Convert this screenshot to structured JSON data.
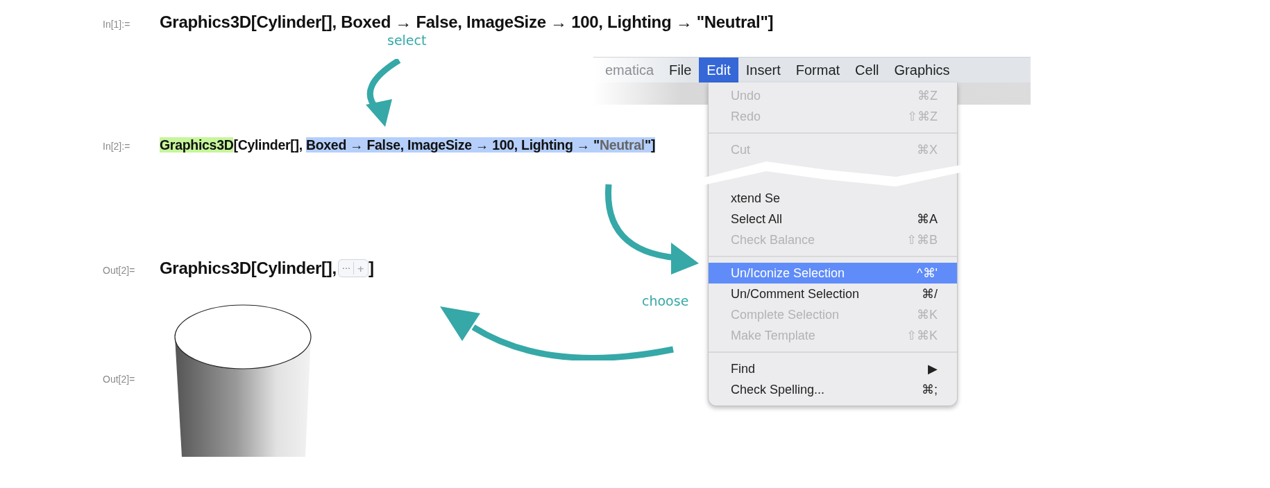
{
  "cells": [
    {
      "kind": "input",
      "label": "In[1]:=",
      "segments": [
        {
          "text": "Graphics3D[Cylinder[], Boxed → False, ImageSize → 100, Lighting → \"Neutral\"]",
          "kind": "plain"
        }
      ]
    },
    {
      "kind": "input-small",
      "label": "In[2]:=",
      "segments": [
        {
          "text": "Graphics3D",
          "kind": "symbol-highlight"
        },
        {
          "text": "[Cylinder[], ",
          "kind": "plain"
        },
        {
          "text": "Boxed → False, ImageSize → 100, Lighting → \"",
          "kind": "selected"
        },
        {
          "text": "Neutral",
          "kind": "selected-string"
        },
        {
          "text": "\"]",
          "kind": "selected"
        }
      ]
    },
    {
      "kind": "output-iconized",
      "label": "Out[2]=",
      "prefix": "Graphics3D[Cylinder[], ",
      "icon_box": {
        "dots": "···",
        "plus": "+"
      },
      "suffix": "]"
    },
    {
      "kind": "output-graphic",
      "label": "Out[2]="
    }
  ],
  "annotations": [
    {
      "text": "select"
    },
    {
      "text": "choose"
    }
  ],
  "menubar": [
    {
      "label": "ematica",
      "selected": false,
      "faded": true
    },
    {
      "label": "File",
      "selected": false,
      "faded": false
    },
    {
      "label": "Edit",
      "selected": true,
      "faded": false
    },
    {
      "label": "Insert",
      "selected": false,
      "faded": false
    },
    {
      "label": "Format",
      "selected": false,
      "faded": false
    },
    {
      "label": "Cell",
      "selected": false,
      "faded": false
    },
    {
      "label": "Graphics",
      "selected": false,
      "faded": false
    }
  ],
  "menu": [
    {
      "kind": "item",
      "label": "Undo",
      "shortcut": "⌘Z",
      "disabled": true,
      "selected": false
    },
    {
      "kind": "item",
      "label": "Redo",
      "shortcut": "⇧⌘Z",
      "disabled": true,
      "selected": false
    },
    {
      "kind": "separator"
    },
    {
      "kind": "item",
      "label": "Cut",
      "shortcut": "⌘X",
      "disabled": true,
      "selected": false
    },
    {
      "kind": "break"
    },
    {
      "kind": "item",
      "label": "xtend Se",
      "disabled": false,
      "selected": false
    },
    {
      "kind": "item",
      "label": "Select All",
      "shortcut": "⌘A",
      "disabled": false,
      "selected": false
    },
    {
      "kind": "item",
      "label": "Check Balance",
      "shortcut": "⇧⌘B",
      "disabled": true,
      "selected": false
    },
    {
      "kind": "separator"
    },
    {
      "kind": "item",
      "label": "Un/Iconize Selection",
      "shortcut": "^⌘'",
      "disabled": false,
      "selected": true
    },
    {
      "kind": "item",
      "label": "Un/Comment Selection",
      "shortcut": "⌘/",
      "disabled": false,
      "selected": false
    },
    {
      "kind": "item",
      "label": "Complete Selection",
      "shortcut": "⌘K",
      "disabled": true,
      "selected": false
    },
    {
      "kind": "item",
      "label": "Make Template",
      "shortcut": "⇧⌘K",
      "disabled": true,
      "selected": false
    },
    {
      "kind": "separator"
    },
    {
      "kind": "item",
      "label": "Find",
      "shortcut": "▶",
      "disabled": false,
      "selected": false
    },
    {
      "kind": "item",
      "label": "Check Spelling...",
      "shortcut": "⌘;",
      "disabled": false,
      "selected": false
    }
  ]
}
